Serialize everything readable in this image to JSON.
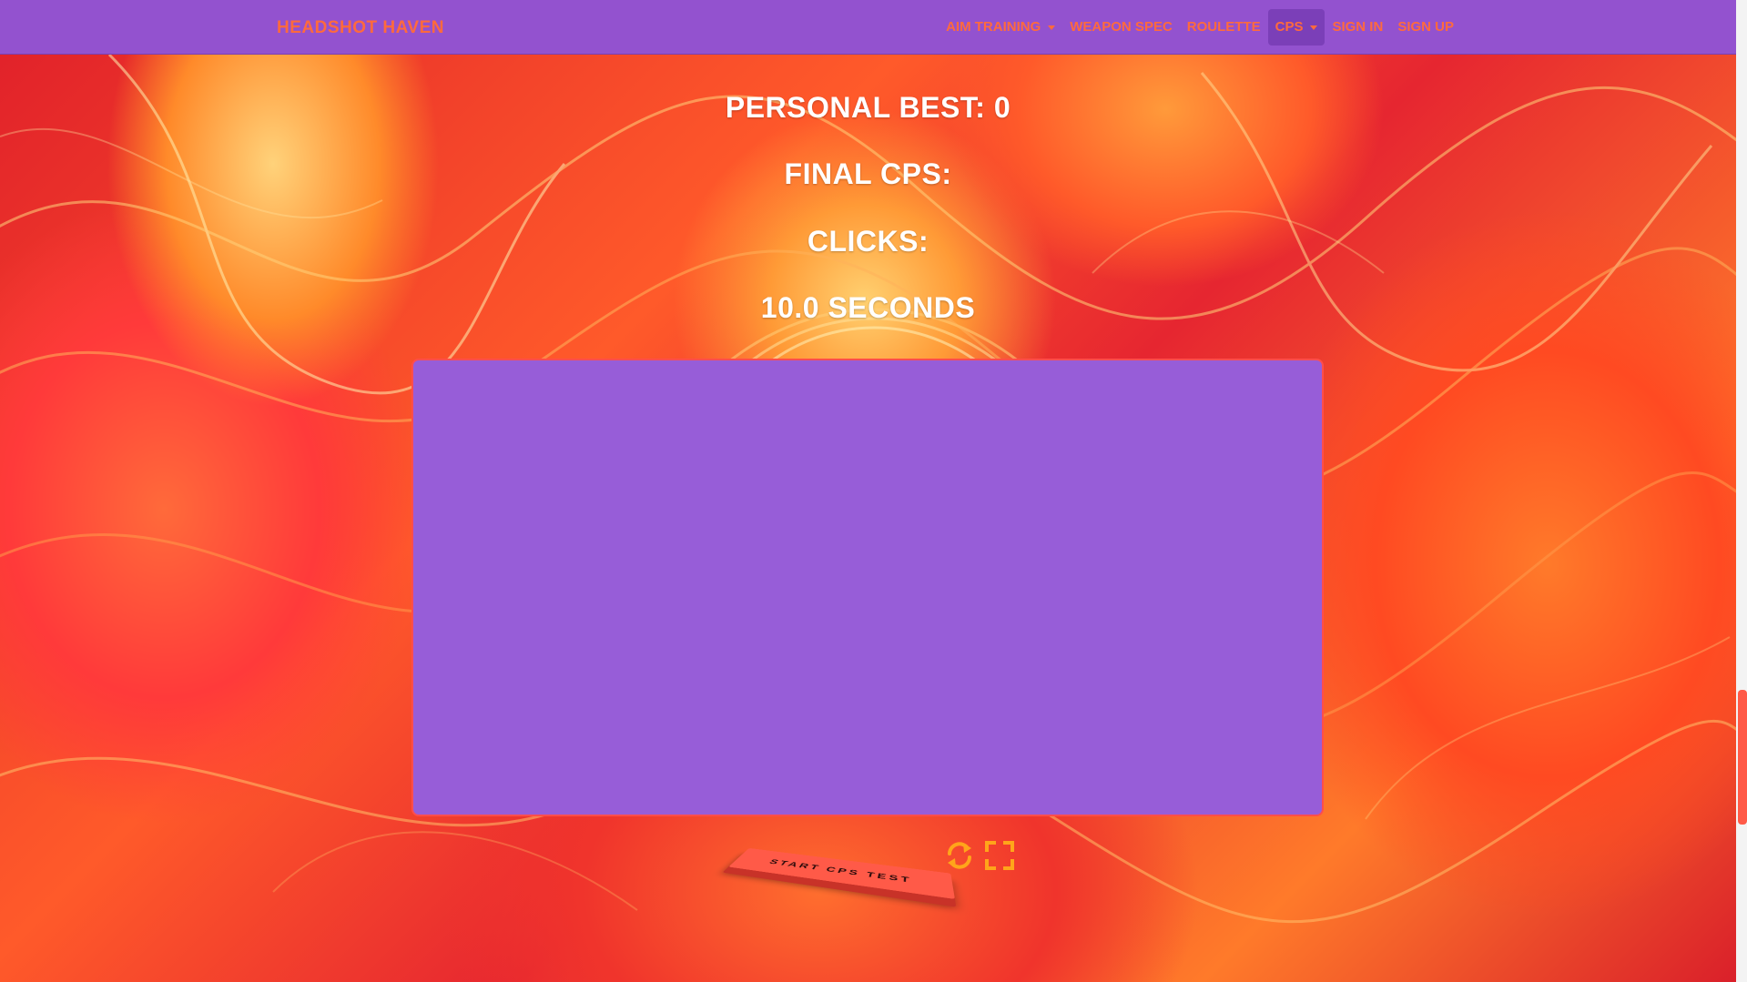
{
  "navbar": {
    "brand": "HEADSHOT HAVEN",
    "items": [
      {
        "label": "AIM TRAINING",
        "dropdown": true,
        "active": false
      },
      {
        "label": "WEAPON SPEC",
        "dropdown": false,
        "active": false
      },
      {
        "label": "ROULETTE",
        "dropdown": false,
        "active": false
      },
      {
        "label": "CPS",
        "dropdown": true,
        "active": true
      },
      {
        "label": "SIGN IN",
        "dropdown": false,
        "active": false
      },
      {
        "label": "SIGN UP",
        "dropdown": false,
        "active": false
      }
    ]
  },
  "stats": {
    "personal_best": "PERSONAL BEST: 0",
    "final_cps": "FINAL CPS:",
    "clicks": "CLICKS:",
    "timer": "10.0 SECONDS"
  },
  "controls": {
    "start_label": "START CPS TEST",
    "restart_icon": "refresh-icon",
    "fullscreen_icon": "fullscreen-icon"
  },
  "colors": {
    "navbar_bg": "#9352cf",
    "accent": "#ff6a3d",
    "click_area_bg": "#975dd8",
    "click_area_border": "#ff4d4d",
    "icon_color": "#ffa51a"
  }
}
